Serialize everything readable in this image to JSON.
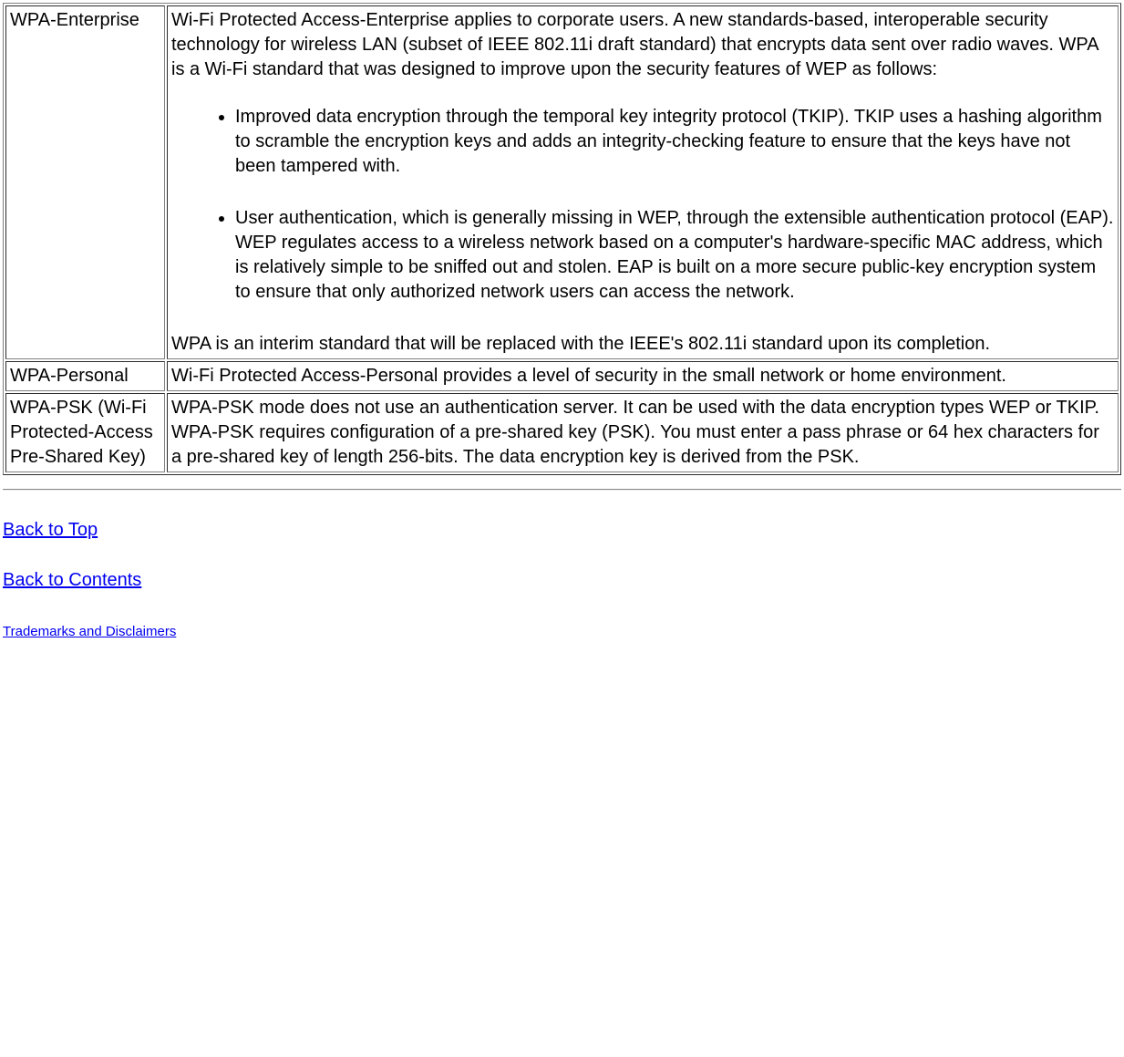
{
  "rows": [
    {
      "term": "WPA-Enterprise",
      "intro": "Wi-Fi Protected Access-Enterprise applies to corporate users. A new standards-based, interoperable security technology for wireless LAN (subset of IEEE 802.11i draft standard) that encrypts data sent over radio waves. WPA is a Wi-Fi standard that was designed to improve upon the security features of WEP as follows:",
      "bullets": [
        "Improved data encryption through the temporal key integrity protocol (TKIP). TKIP uses a hashing algorithm to scramble the encryption keys and adds an integrity-checking feature to ensure that the keys have not been tampered with.",
        "User authentication, which is generally missing in WEP, through the extensible authentication protocol (EAP). WEP regulates access to a wireless network based on a computer's hardware-specific MAC address, which is relatively simple to be sniffed out and stolen. EAP is built on a more secure public-key encryption system to ensure that only authorized network users can access the network."
      ],
      "outro": "WPA is an interim standard that will be replaced with the IEEE's 802.11i standard upon its completion."
    },
    {
      "term": "WPA-Personal",
      "definition": "Wi-Fi Protected Access-Personal provides a level of security in the small network or home environment."
    },
    {
      "term": "WPA-PSK (Wi-Fi Protected-Access Pre-Shared Key)",
      "definition": "WPA-PSK mode does not use an authentication server. It can be used with the data encryption types WEP or TKIP. WPA-PSK requires configuration of a pre-shared key (PSK). You must enter a pass phrase or 64 hex characters for a pre-shared key of length 256-bits. The data encryption key is derived from the PSK."
    }
  ],
  "links": {
    "back_to_top": "Back to Top",
    "back_to_contents": "Back to Contents",
    "trademarks": "Trademarks and Disclaimers"
  }
}
